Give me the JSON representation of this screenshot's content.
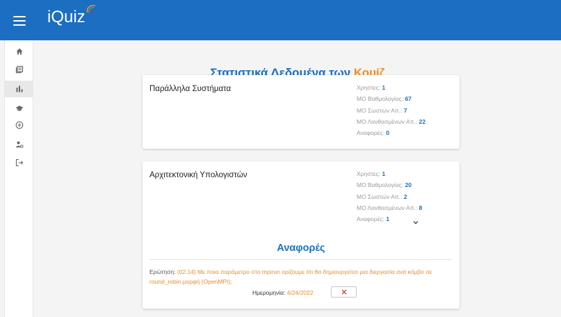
{
  "app": {
    "logo": "iQuiz"
  },
  "sidebar": {
    "items": [
      {
        "icon": "home-icon"
      },
      {
        "icon": "library-icon"
      },
      {
        "icon": "bar-chart-icon",
        "active": true
      },
      {
        "icon": "graduation-cap-icon"
      },
      {
        "icon": "add-circle-icon"
      },
      {
        "icon": "user-settings-icon"
      },
      {
        "icon": "logout-icon"
      }
    ]
  },
  "page": {
    "title_main": "Στατιστικά Δεδομένα των ",
    "title_accent": "Κουίζ"
  },
  "quizzes": [
    {
      "title": "Παράλληλα Συστήματα",
      "stats": [
        {
          "label": "Χρηστες: ",
          "value": "1"
        },
        {
          "label": "ΜΟ Βαθμολογίας: ",
          "value": "67"
        },
        {
          "label": "ΜΟ Σωστών Απ.: ",
          "value": "7"
        },
        {
          "label": "ΜΟ Λανθασμένων Απ.: ",
          "value": "22"
        },
        {
          "label": "Αναφορές: ",
          "value": "0"
        }
      ]
    },
    {
      "title": "Αρχιτεκτονική Υπολογιστών",
      "stats": [
        {
          "label": "Χρηστες: ",
          "value": "1"
        },
        {
          "label": "ΜΟ Βαθμολογίας: ",
          "value": "20"
        },
        {
          "label": "ΜΟ Σωστών Απ.: ",
          "value": "2"
        },
        {
          "label": "ΜΟ Λανθασμένων Απ.: ",
          "value": "8"
        },
        {
          "label": "Αναφορές: ",
          "value": "1"
        }
      ],
      "reports": {
        "title": "Αναφορές",
        "question_label": "Ερώτηση: ",
        "question_text": "(02.14) Με ποια παράμετρο στο mpirun ορίζουμε ότι θα δημιουργείται μια διεργασία ανά κόμβο σε round_robin μορφή (OpenMPI);",
        "date_label": "Ημερομηνία: ",
        "date_value": "4/24/2022"
      }
    }
  ],
  "colors": {
    "primary": "#1b6ec2",
    "accent": "#f28c28",
    "delete": "#e53935"
  }
}
